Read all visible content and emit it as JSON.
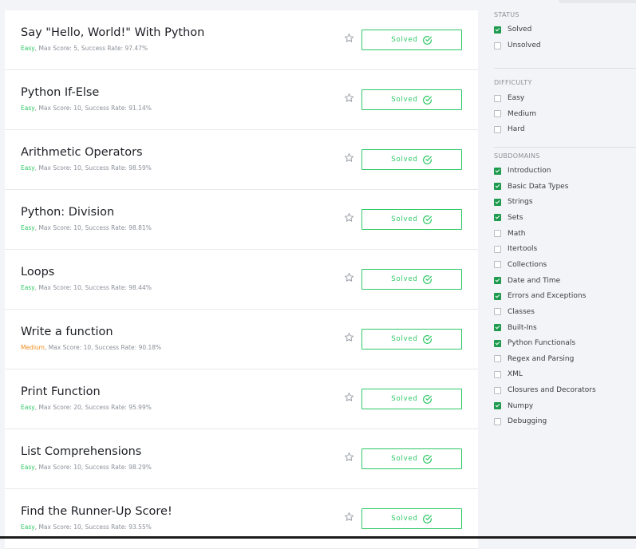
{
  "challenges": [
    {
      "title": "Say \"Hello, World!\" With Python",
      "difficulty": "Easy",
      "difficulty_color": "#2ec866",
      "meta": ", Max Score: 5, Success Rate: 97.47%",
      "button_label": "Solved"
    },
    {
      "title": "Python If-Else",
      "difficulty": "Easy",
      "difficulty_color": "#2ec866",
      "meta": ", Max Score: 10, Success Rate: 91.14%",
      "button_label": "Solved"
    },
    {
      "title": "Arithmetic Operators",
      "difficulty": "Easy",
      "difficulty_color": "#2ec866",
      "meta": ", Max Score: 10, Success Rate: 98.59%",
      "button_label": "Solved"
    },
    {
      "title": "Python: Division",
      "difficulty": "Easy",
      "difficulty_color": "#2ec866",
      "meta": ", Max Score: 10, Success Rate: 98.81%",
      "button_label": "Solved"
    },
    {
      "title": "Loops",
      "difficulty": "Easy",
      "difficulty_color": "#2ec866",
      "meta": ", Max Score: 10, Success Rate: 98.44%",
      "button_label": "Solved"
    },
    {
      "title": "Write a function",
      "difficulty": "Medium",
      "difficulty_color": "#f28e1f",
      "meta": ", Max Score: 10, Success Rate: 90.18%",
      "button_label": "Solved"
    },
    {
      "title": "Print Function",
      "difficulty": "Easy",
      "difficulty_color": "#2ec866",
      "meta": ", Max Score: 20, Success Rate: 95.99%",
      "button_label": "Solved"
    },
    {
      "title": "List Comprehensions",
      "difficulty": "Easy",
      "difficulty_color": "#2ec866",
      "meta": ", Max Score: 10, Success Rate: 98.29%",
      "button_label": "Solved"
    },
    {
      "title": "Find the Runner-Up Score!",
      "difficulty": "Easy",
      "difficulty_color": "#2ec866",
      "meta": ", Max Score: 10, Success Rate: 93.55%",
      "button_label": "Solved"
    }
  ],
  "icons": {
    "bookmark": "star-icon",
    "solved": "check-circle-icon"
  },
  "colors": {
    "accent_green": "#2ec866",
    "medium_orange": "#f28e1f",
    "checkbox_checked": "#1f9b4f"
  },
  "filters": {
    "status": {
      "title": "STATUS",
      "options": [
        {
          "label": "Solved",
          "checked": true
        },
        {
          "label": "Unsolved",
          "checked": false
        }
      ]
    },
    "difficulty": {
      "title": "DIFFICULTY",
      "options": [
        {
          "label": "Easy",
          "checked": false
        },
        {
          "label": "Medium",
          "checked": false
        },
        {
          "label": "Hard",
          "checked": false
        }
      ]
    },
    "subdomains": {
      "title": "SUBDOMAINS",
      "options": [
        {
          "label": "Introduction",
          "checked": true
        },
        {
          "label": "Basic Data Types",
          "checked": true
        },
        {
          "label": "Strings",
          "checked": true
        },
        {
          "label": "Sets",
          "checked": true
        },
        {
          "label": "Math",
          "checked": false
        },
        {
          "label": "Itertools",
          "checked": false
        },
        {
          "label": "Collections",
          "checked": false
        },
        {
          "label": "Date and Time",
          "checked": true
        },
        {
          "label": "Errors and Exceptions",
          "checked": true
        },
        {
          "label": "Classes",
          "checked": false
        },
        {
          "label": "Built-Ins",
          "checked": true
        },
        {
          "label": "Python Functionals",
          "checked": true
        },
        {
          "label": "Regex and Parsing",
          "checked": false
        },
        {
          "label": "XML",
          "checked": false
        },
        {
          "label": "Closures and Decorators",
          "checked": false
        },
        {
          "label": "Numpy",
          "checked": true
        },
        {
          "label": "Debugging",
          "checked": false
        }
      ]
    }
  }
}
